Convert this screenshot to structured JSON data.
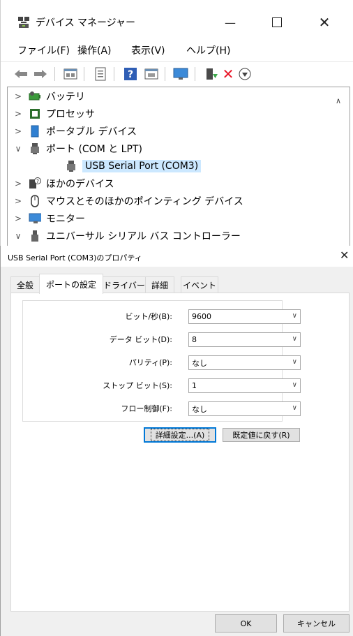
{
  "device_manager": {
    "title": "デバイス マネージャー",
    "menu": [
      "ファイル(F)",
      "操作(A)",
      "表示(V)",
      "ヘルプ(H)"
    ],
    "toolbar_icons": [
      "back-icon",
      "forward-icon",
      "computer-icon",
      "properties-icon",
      "help-icon",
      "driver-details-icon",
      "monitor-icon",
      "update-driver-icon",
      "uninstall-x-icon",
      "enable-device-icon"
    ],
    "tree": [
      {
        "label": "バッテリ",
        "expanded": false,
        "icon": "battery-icon"
      },
      {
        "label": "プロセッサ",
        "expanded": false,
        "icon": "processor-icon"
      },
      {
        "label": "ポータブル デバイス",
        "expanded": false,
        "icon": "portable-device-icon"
      },
      {
        "label": "ポート (COM と LPT)",
        "expanded": true,
        "icon": "port-icon"
      },
      {
        "label": "USB Serial Port (COM3)",
        "child": true,
        "selected": true,
        "icon": "port-icon"
      },
      {
        "label": "ほかのデバイス",
        "expanded": false,
        "icon": "other-device-icon"
      },
      {
        "label": "マウスとそのほかのポインティング デバイス",
        "expanded": false,
        "icon": "mouse-icon"
      },
      {
        "label": "モニター",
        "expanded": false,
        "icon": "monitor-icon"
      },
      {
        "label": "ユニバーサル シリアル バス コントローラー",
        "expanded": true,
        "icon": "usb-controller-icon"
      }
    ]
  },
  "dialog": {
    "title": "USB Serial Port (COM3)のプロパティ",
    "tabs": [
      "全般",
      "ポートの設定",
      "ドライバー",
      "詳細",
      "イベント"
    ],
    "active_tab": "ポートの設定",
    "fields": [
      {
        "label": "ビット/秒(B):",
        "value": "9600"
      },
      {
        "label": "データ ビット(D):",
        "value": "8"
      },
      {
        "label": "パリティ(P):",
        "value": "なし"
      },
      {
        "label": "ストップ ビット(S):",
        "value": "1"
      },
      {
        "label": "フロー制御(F):",
        "value": "なし"
      }
    ],
    "advanced_button": "詳細設定...(A)",
    "restore_button": "既定値に戻す(R)",
    "ok_button": "OK",
    "cancel_button": "キャンセル"
  },
  "colors": {
    "selection": "#cce8ff",
    "accent": "#0078d7",
    "dialog_bg": "#f0f0f0"
  }
}
